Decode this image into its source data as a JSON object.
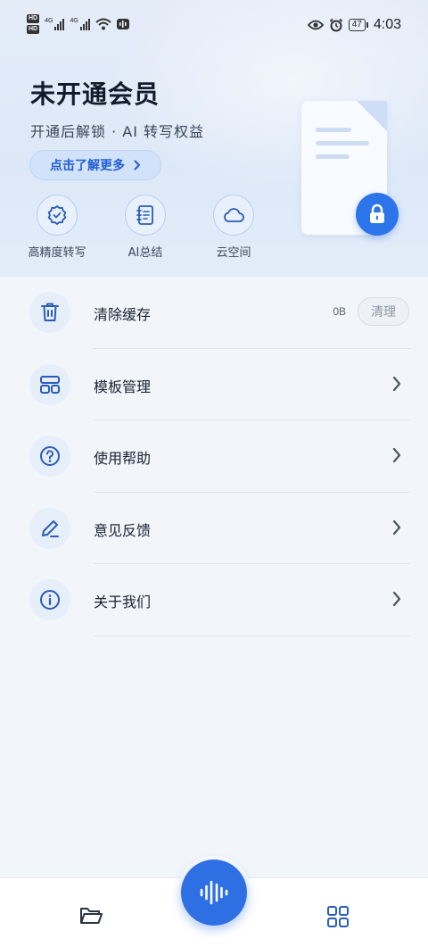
{
  "status_bar": {
    "time": "4:03",
    "battery": "47",
    "network_1": "4G",
    "network_2": "4G",
    "hd_1": "HD",
    "hd_2": "HD"
  },
  "header": {
    "title": "未开通会员",
    "subtitle": "开通后解锁 · AI 转写权益",
    "cta_label": "点击了解更多",
    "cta_icon": "chevron-right-icon",
    "benefits": [
      {
        "label": "高精度转写",
        "icon": "badge-check-icon"
      },
      {
        "label": "AI总结",
        "icon": "notebook-icon"
      },
      {
        "label": "云空间",
        "icon": "cloud-icon"
      }
    ]
  },
  "menu": {
    "items": [
      {
        "label": "清除缓存",
        "icon": "trash-icon",
        "size": "0B",
        "action": "清理"
      },
      {
        "label": "模板管理",
        "icon": "template-icon"
      },
      {
        "label": "使用帮助",
        "icon": "help-icon"
      },
      {
        "label": "意见反馈",
        "icon": "edit-icon"
      },
      {
        "label": "关于我们",
        "icon": "info-icon"
      }
    ]
  },
  "tab_bar": {
    "left_icon": "folder-icon",
    "center_icon": "waveform-icon",
    "right_icon": "grid-icon"
  },
  "colors": {
    "accent": "#2f6fe4",
    "icon_blue": "#2a5db8",
    "hero_bg": "#e0eaf8",
    "page_bg": "#f2f6fb"
  }
}
